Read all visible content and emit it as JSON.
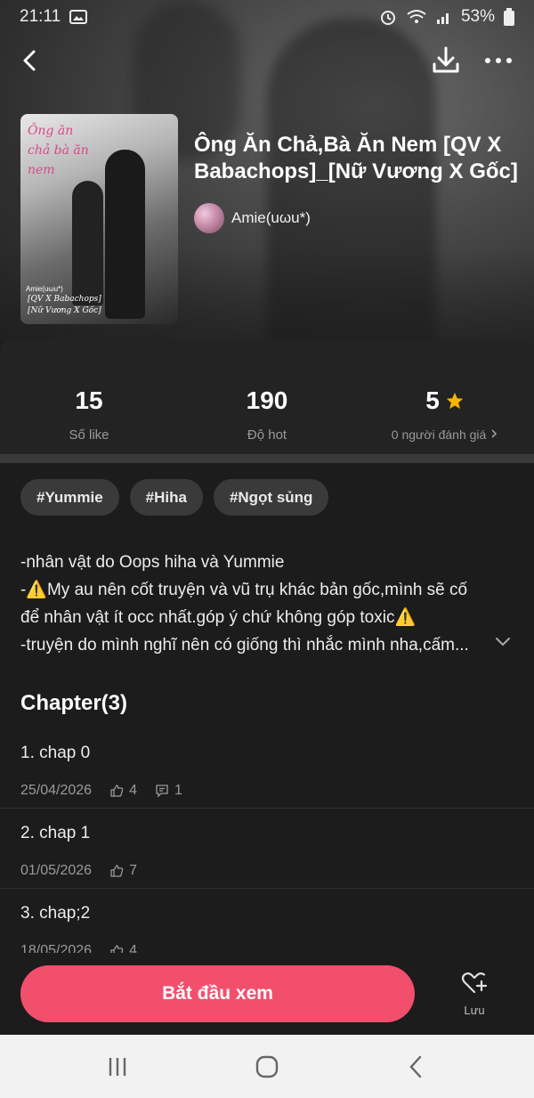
{
  "status_bar": {
    "time": "21:11",
    "battery": "53%"
  },
  "book": {
    "title": "Ông Ăn Chả,Bà Ăn Nem [QV X Babachops]_[Nữ Vương X Gốc]",
    "author": "Amie(uωu*)",
    "cover": {
      "title_text": "Ông ăn chả bà ăn nem",
      "author_text": "Amie(uωu*)",
      "sub_line1": "[QV X Babachops]",
      "sub_line2": "[Nữ Vương X Gốc]"
    }
  },
  "stats": [
    {
      "value": "15",
      "label": "Số like"
    },
    {
      "value": "190",
      "label": "Độ hot"
    },
    {
      "value": "5",
      "label": "0 người đánh giá"
    }
  ],
  "tags": [
    "#Yummie",
    "#Hiha",
    "#Ngọt sủng"
  ],
  "description": [
    "-nhân vật do Oops hiha và Yummie",
    "-⚠️My au nên cốt truyện và vũ trụ khác bản gốc,mình sẽ cố",
    "để nhân vật ít occ nhất.góp ý chứ không góp toxic⚠️",
    "-truyện do mình nghĩ nên có giống thì nhắc mình nha,cấm..."
  ],
  "chapters_heading": "Chapter(3)",
  "chapters": [
    {
      "title": "1. chap 0",
      "date": "25/04/2026",
      "likes": "4",
      "comments": "1"
    },
    {
      "title": "2. chap 1",
      "date": "01/05/2026",
      "likes": "7"
    },
    {
      "title": "3. chap;2",
      "date": "18/05/2026",
      "likes": "4"
    }
  ],
  "actions": {
    "start": "Bắt đầu xem",
    "save": "Lưu"
  },
  "colors": {
    "accent": "#f24f6d",
    "star": "#f7b500",
    "background": "#1c1c1c"
  }
}
